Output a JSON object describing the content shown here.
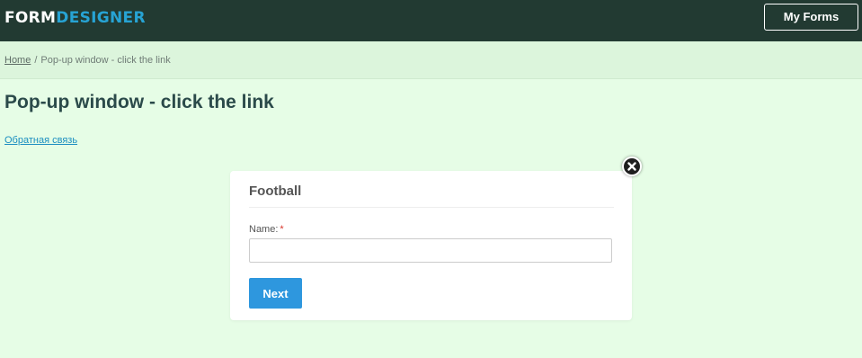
{
  "header": {
    "logo_part1": "FORM",
    "logo_part2": "DESIGNER",
    "my_forms_label": "My Forms"
  },
  "breadcrumb": {
    "home": "Home",
    "separator": "/",
    "current": "Pop-up window - click the link"
  },
  "page": {
    "title": "Pop-up window - click the link",
    "feedback_link": "Обратная связь"
  },
  "modal": {
    "title": "Football",
    "name_label": "Name:",
    "required_marker": "*",
    "name_value": "",
    "next_label": "Next",
    "close_icon": "close-icon"
  },
  "colors": {
    "header_bg": "#223a32",
    "page_bg": "#e6fde6",
    "accent": "#2e97de",
    "logo_accent": "#27a3d4",
    "required": "#d9362b"
  }
}
